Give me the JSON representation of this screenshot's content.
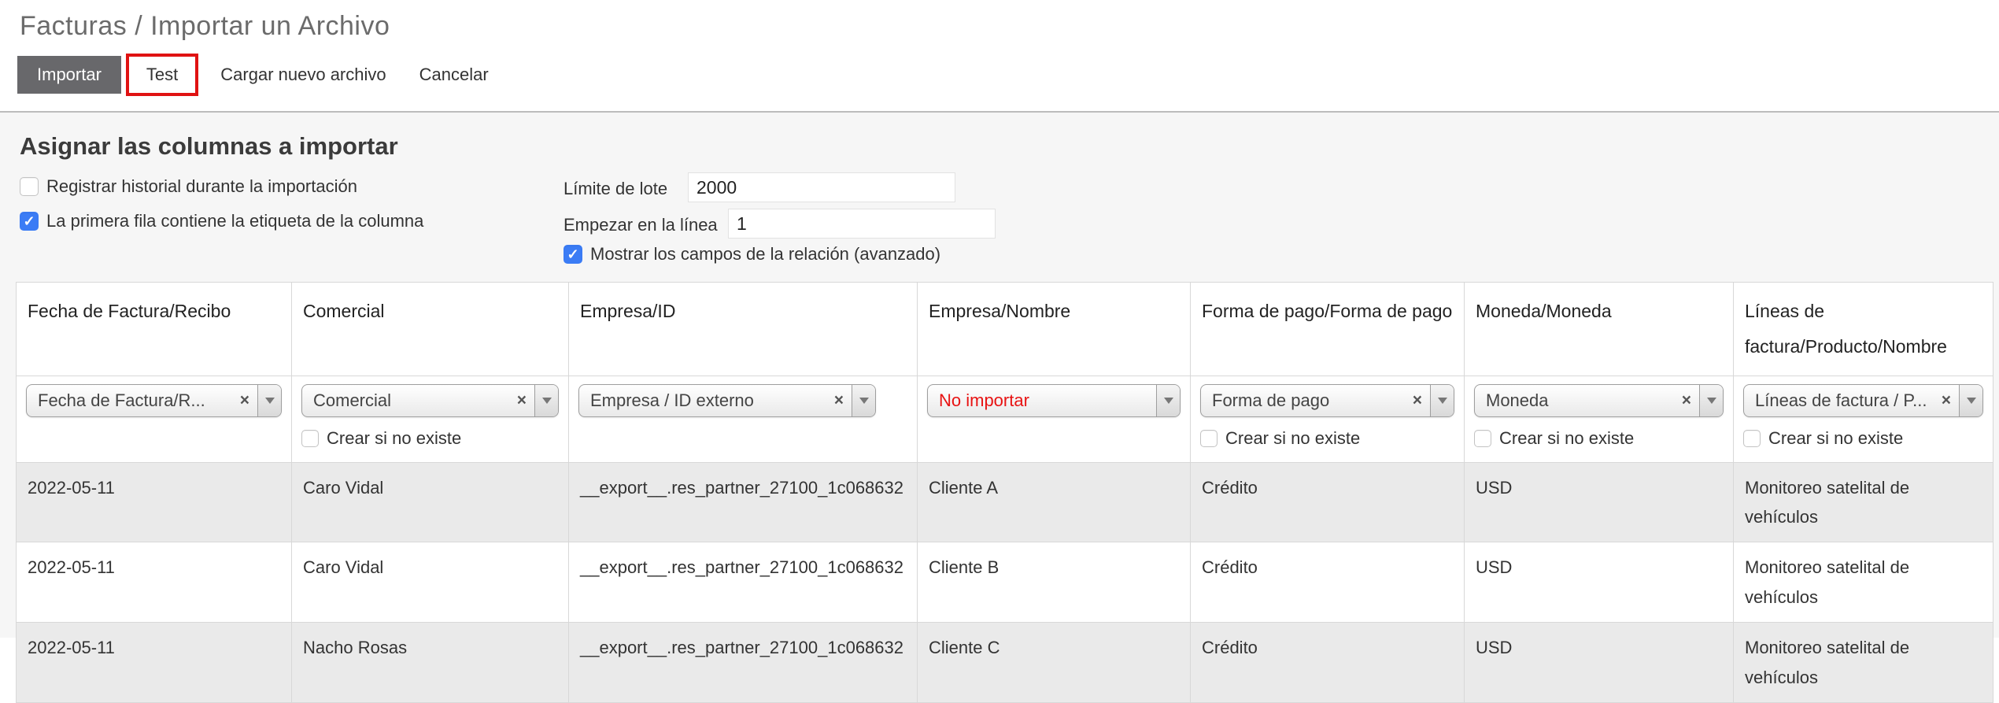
{
  "page": {
    "title": "Facturas / Importar un Archivo"
  },
  "toolbar": {
    "import_label": "Importar",
    "test_label": "Test",
    "load_new_file_label": "Cargar nuevo archivo",
    "cancel_label": "Cancelar"
  },
  "options": {
    "section_title": "Asignar las columnas a importar",
    "track_history_label": "Registrar historial durante la importación",
    "track_history_checked": false,
    "first_row_header_label": "La primera fila contiene la etiqueta de la columna",
    "first_row_header_checked": true,
    "batch_limit_label": "Límite de lote",
    "batch_limit_value": "2000",
    "start_line_label": "Empezar en la línea",
    "start_line_value": "1",
    "show_relational_label": "Mostrar los campos de la relación (avanzado)",
    "show_relational_checked": true
  },
  "icons": {
    "clear": "×"
  },
  "table": {
    "create_if_not_exists_label": "Crear si no existe",
    "columns": [
      {
        "header": "Fecha de Factura/Recibo",
        "select_value": "Fecha de Factura/R...",
        "clearable": true,
        "create_checkbox": false,
        "no_import": false
      },
      {
        "header": "Comercial",
        "select_value": "Comercial",
        "clearable": true,
        "create_checkbox": true,
        "no_import": false
      },
      {
        "header": "Empresa/ID",
        "select_value": "Empresa / ID externo",
        "clearable": true,
        "create_checkbox": false,
        "no_import": false
      },
      {
        "header": "Empresa/Nombre",
        "select_value": "No importar",
        "clearable": false,
        "create_checkbox": false,
        "no_import": true
      },
      {
        "header": "Forma de pago/Forma de pago",
        "select_value": "Forma de pago",
        "clearable": true,
        "create_checkbox": true,
        "no_import": false
      },
      {
        "header": "Moneda/Moneda",
        "select_value": "Moneda",
        "clearable": true,
        "create_checkbox": true,
        "no_import": false
      },
      {
        "header": "Líneas de factura/Producto/Nombre",
        "select_value": "Líneas de factura / P...",
        "clearable": true,
        "create_checkbox": true,
        "no_import": false
      }
    ],
    "rows": [
      [
        "2022-05-11",
        "Caro Vidal",
        "__export__.res_partner_27100_1c068632",
        "Cliente A",
        "Crédito",
        "USD",
        "Monitoreo satelital de vehículos"
      ],
      [
        "2022-05-11",
        "Caro Vidal",
        "__export__.res_partner_27100_1c068632",
        "Cliente B",
        "Crédito",
        "USD",
        "Monitoreo satelital de vehículos"
      ],
      [
        "2022-05-11",
        "Nacho Rosas",
        "__export__.res_partner_27100_1c068632",
        "Cliente C",
        "Crédito",
        "USD",
        "Monitoreo satelital de vehículos"
      ]
    ]
  },
  "colors": {
    "annotation_red": "#e01212",
    "no_import_red": "#e81313",
    "checkbox_blue": "#3b7cf5",
    "import_button_gray": "#68686b",
    "row_alt_gray": "#eaeaea",
    "page_background": "#f6f6f6"
  }
}
